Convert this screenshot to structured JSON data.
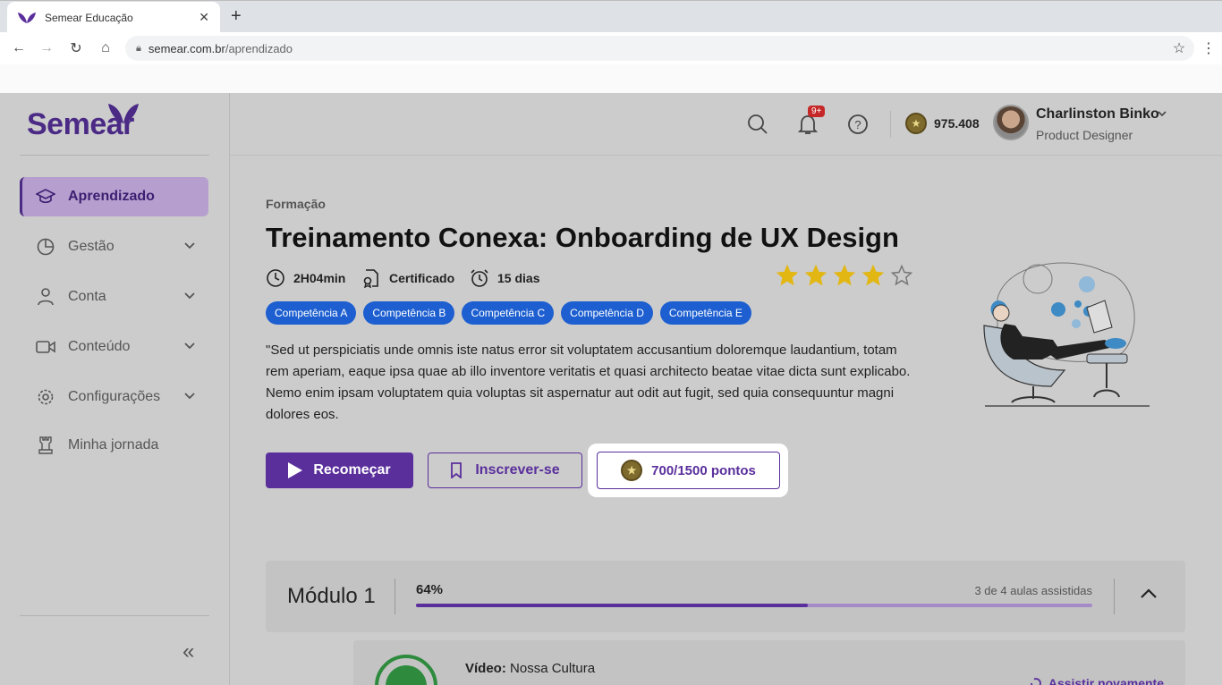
{
  "browser": {
    "tab_title": "Semear Educação",
    "url_host": "semear.com.br",
    "url_path": "/aprendizado"
  },
  "sidebar": {
    "logo": "Semear",
    "items": [
      {
        "label": "Aprendizado",
        "icon": "graduation-cap-icon",
        "active": true
      },
      {
        "label": "Gestão",
        "icon": "pie-chart-icon"
      },
      {
        "label": "Conta",
        "icon": "user-icon"
      },
      {
        "label": "Conteúdo",
        "icon": "video-icon"
      },
      {
        "label": "Configurações",
        "icon": "gear-icon"
      },
      {
        "label": "Minha jornada",
        "icon": "chess-rook-icon"
      }
    ],
    "collapse_glyph": "«"
  },
  "topbar": {
    "notifications_badge": "9+",
    "points": "975.408",
    "user_name": "Charlinston Binko",
    "user_role": "Product Designer"
  },
  "course": {
    "breadcrumb": "Formação",
    "title": "Treinamento Conexa: Onboarding de UX Design",
    "duration": "2H04min",
    "certificate": "Certificado",
    "deadline": "15 dias",
    "rating": 4,
    "rating_max": 5,
    "competencies": [
      "Competência A",
      "Competência B",
      "Competência C",
      "Competência D",
      "Competência E"
    ],
    "description": "\"Sed ut perspiciatis unde omnis iste natus error sit voluptatem accusantium doloremque laudantium, totam rem aperiam, eaque ipsa quae ab illo inventore veritatis et quasi architecto beatae vitae dicta sunt explicabo. Nemo enim ipsam voluptatem quia voluptas sit aspernatur aut odit aut fugit, sed quia consequuntur magni dolores eos.",
    "restart_label": "Recomeçar",
    "subscribe_label": "Inscrever-se",
    "points_label": "700/1500 pontos"
  },
  "module": {
    "title": "Módulo 1",
    "progress_label": "64%",
    "progress": 0.58,
    "lessons_count": "3 de 4 aulas assistidas"
  },
  "lesson": {
    "type": "Vídeo:",
    "name": "Nossa Cultura",
    "rewatch_label": "Assistir novamente"
  },
  "colors": {
    "brand": "#5a2f9c",
    "chip": "#1d5fd0",
    "star": "#e2b714"
  }
}
